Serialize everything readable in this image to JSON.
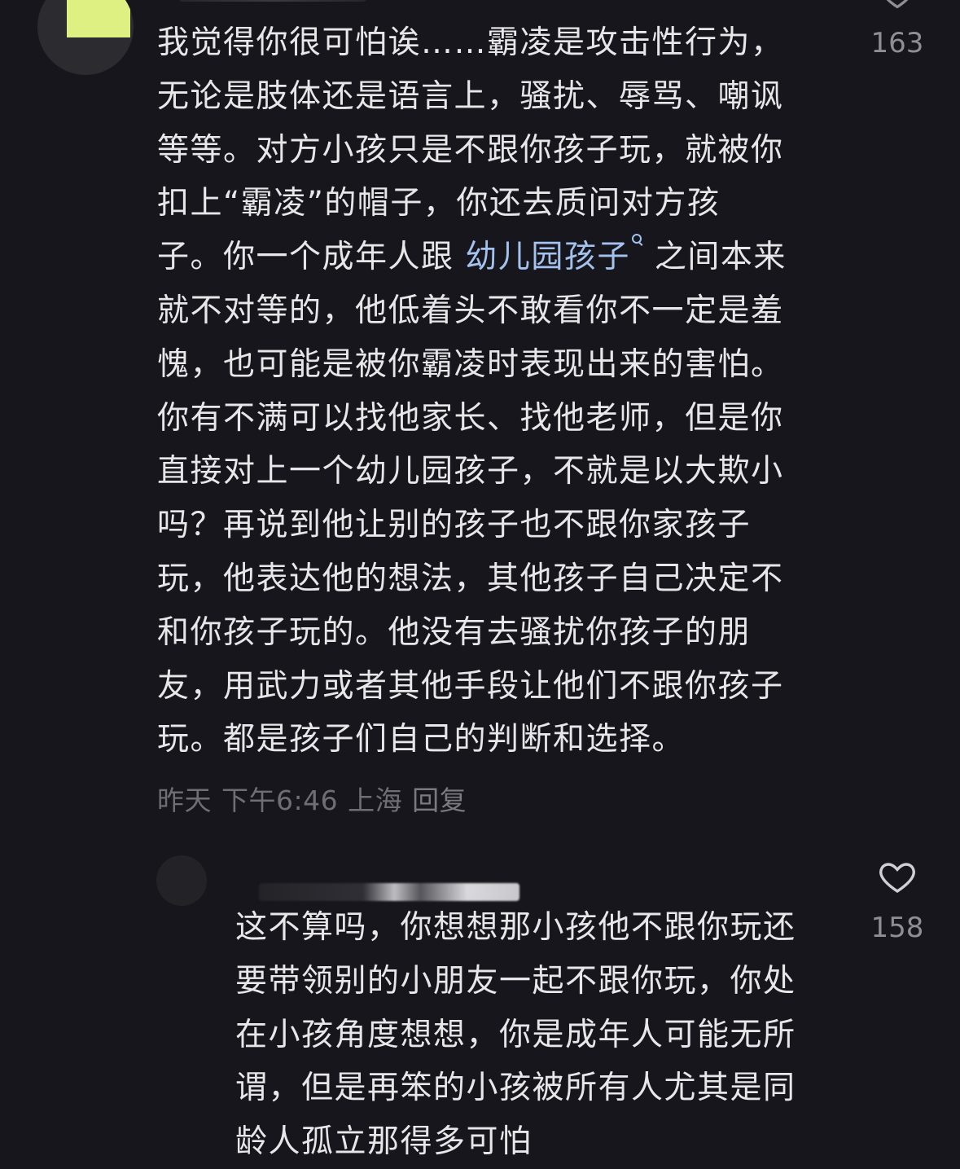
{
  "main_comment": {
    "lines": [
      "我觉得你很可怕诶……霸凌是攻击性行为，",
      "无论是肢体还是语言上，骚扰、辱骂、嘲讽",
      "等等。对方小孩只是不跟你孩子玩，就被你",
      "扣上“霸凌”的帽子，你还去质问对方孩",
      "子。你一个成年人跟 ",
      "就不对等的，他低着头不敢看你不一定是羞",
      "愧，也可能是被你霸凌时表现出来的害怕。",
      "你有不满可以找他家长、找他老师，但是你",
      "直接对上一个幼儿园孩子，不就是以大欺小",
      "吗？再说到他让别的孩子也不跟你家孩子",
      "玩，他表达他的想法，其他孩子自己决定不",
      "和你孩子玩的。他没有去骚扰你孩子的朋",
      "友，用武力或者其他手段让他们不跟你孩子",
      "玩。都是孩子们自己的判断和选择。"
    ],
    "link_text": "幼儿园孩子",
    "after_link": " 之间本来",
    "meta": {
      "date": "昨天",
      "time": "下午6:46",
      "location": "上海",
      "reply_label": "回复"
    },
    "likes": "163"
  },
  "reply_comment": {
    "lines": [
      "这不算吗，你想想那小孩他不跟你玩还",
      "要带领别的小朋友一起不跟你玩，你处",
      "在小孩角度想想，你是成年人可能无所",
      "谓，但是再笨的小孩被所有人尤其是同",
      "龄人孤立那得多可怕"
    ],
    "likes": "158"
  },
  "colors": {
    "background": "#16161c",
    "text": "#e7e7ea",
    "link": "#a4c2ee",
    "meta": "#6e6e74",
    "like_count": "#8e8e94",
    "avatar_sticker": "#dff083"
  },
  "icons": {
    "like": "heart-icon",
    "link_search": "search-icon"
  }
}
